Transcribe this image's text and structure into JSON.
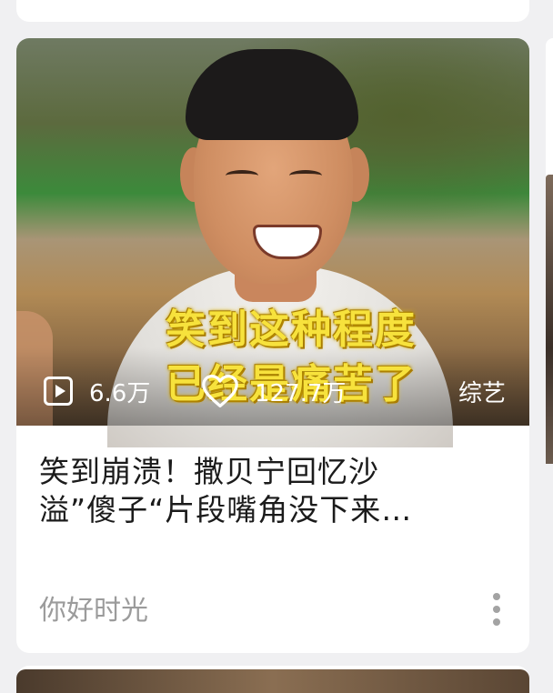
{
  "card": {
    "overlay_line1": "笑到这种程度",
    "overlay_line2": "已经是痛苦了",
    "play_count": "6.6万",
    "like_count": "127.7万",
    "category_tag": "综艺",
    "title_line1": "笑到崩溃！撒贝宁回忆沙",
    "title_line2": "溢”傻子“片段嘴角没下来…",
    "source": "你好时光"
  },
  "icons": {
    "play": "play-count-icon",
    "like": "heart-icon",
    "more": "more-vertical-icon"
  },
  "colors": {
    "overlay_text": "#f7e23c",
    "title_text": "#1b1b1b",
    "source_text": "#9b9b9b",
    "background": "#f0f0f2"
  }
}
